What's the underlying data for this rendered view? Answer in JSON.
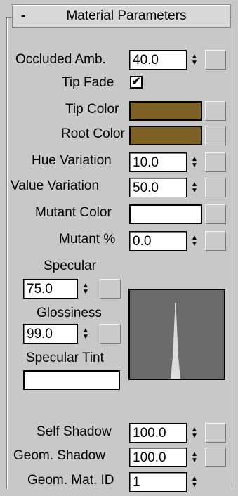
{
  "header": {
    "collapse_symbol": "-",
    "title": "Material Parameters"
  },
  "fields": {
    "occluded_amb": {
      "label": "Occluded Amb.",
      "value": "40.0"
    },
    "tip_fade": {
      "label": "Tip Fade",
      "checked_glyph": "✔"
    },
    "tip_color": {
      "label": "Tip Color",
      "color": "#7e6124"
    },
    "root_color": {
      "label": "Root Color",
      "color": "#7e6124"
    },
    "hue_variation": {
      "label": "Hue Variation",
      "value": "10.0"
    },
    "value_variation": {
      "label": "Value Variation",
      "value": "50.0"
    },
    "mutant_color": {
      "label": "Mutant Color",
      "color": "#ffffff"
    },
    "mutant_pct": {
      "label": "Mutant %",
      "value": "0.0"
    },
    "specular": {
      "label": "Specular",
      "value": "75.0"
    },
    "glossiness": {
      "label": "Glossiness",
      "value": "99.0"
    },
    "specular_tint": {
      "label": "Specular Tint",
      "color": "#ffffff"
    },
    "self_shadow": {
      "label": "Self Shadow",
      "value": "100.0"
    },
    "geom_shadow": {
      "label": "Geom. Shadow",
      "value": "100.0"
    },
    "geom_mat_id": {
      "label": "Geom. Mat. ID",
      "value": "1"
    }
  },
  "spinner_glyphs": {
    "up": "▲",
    "down": "▼"
  }
}
